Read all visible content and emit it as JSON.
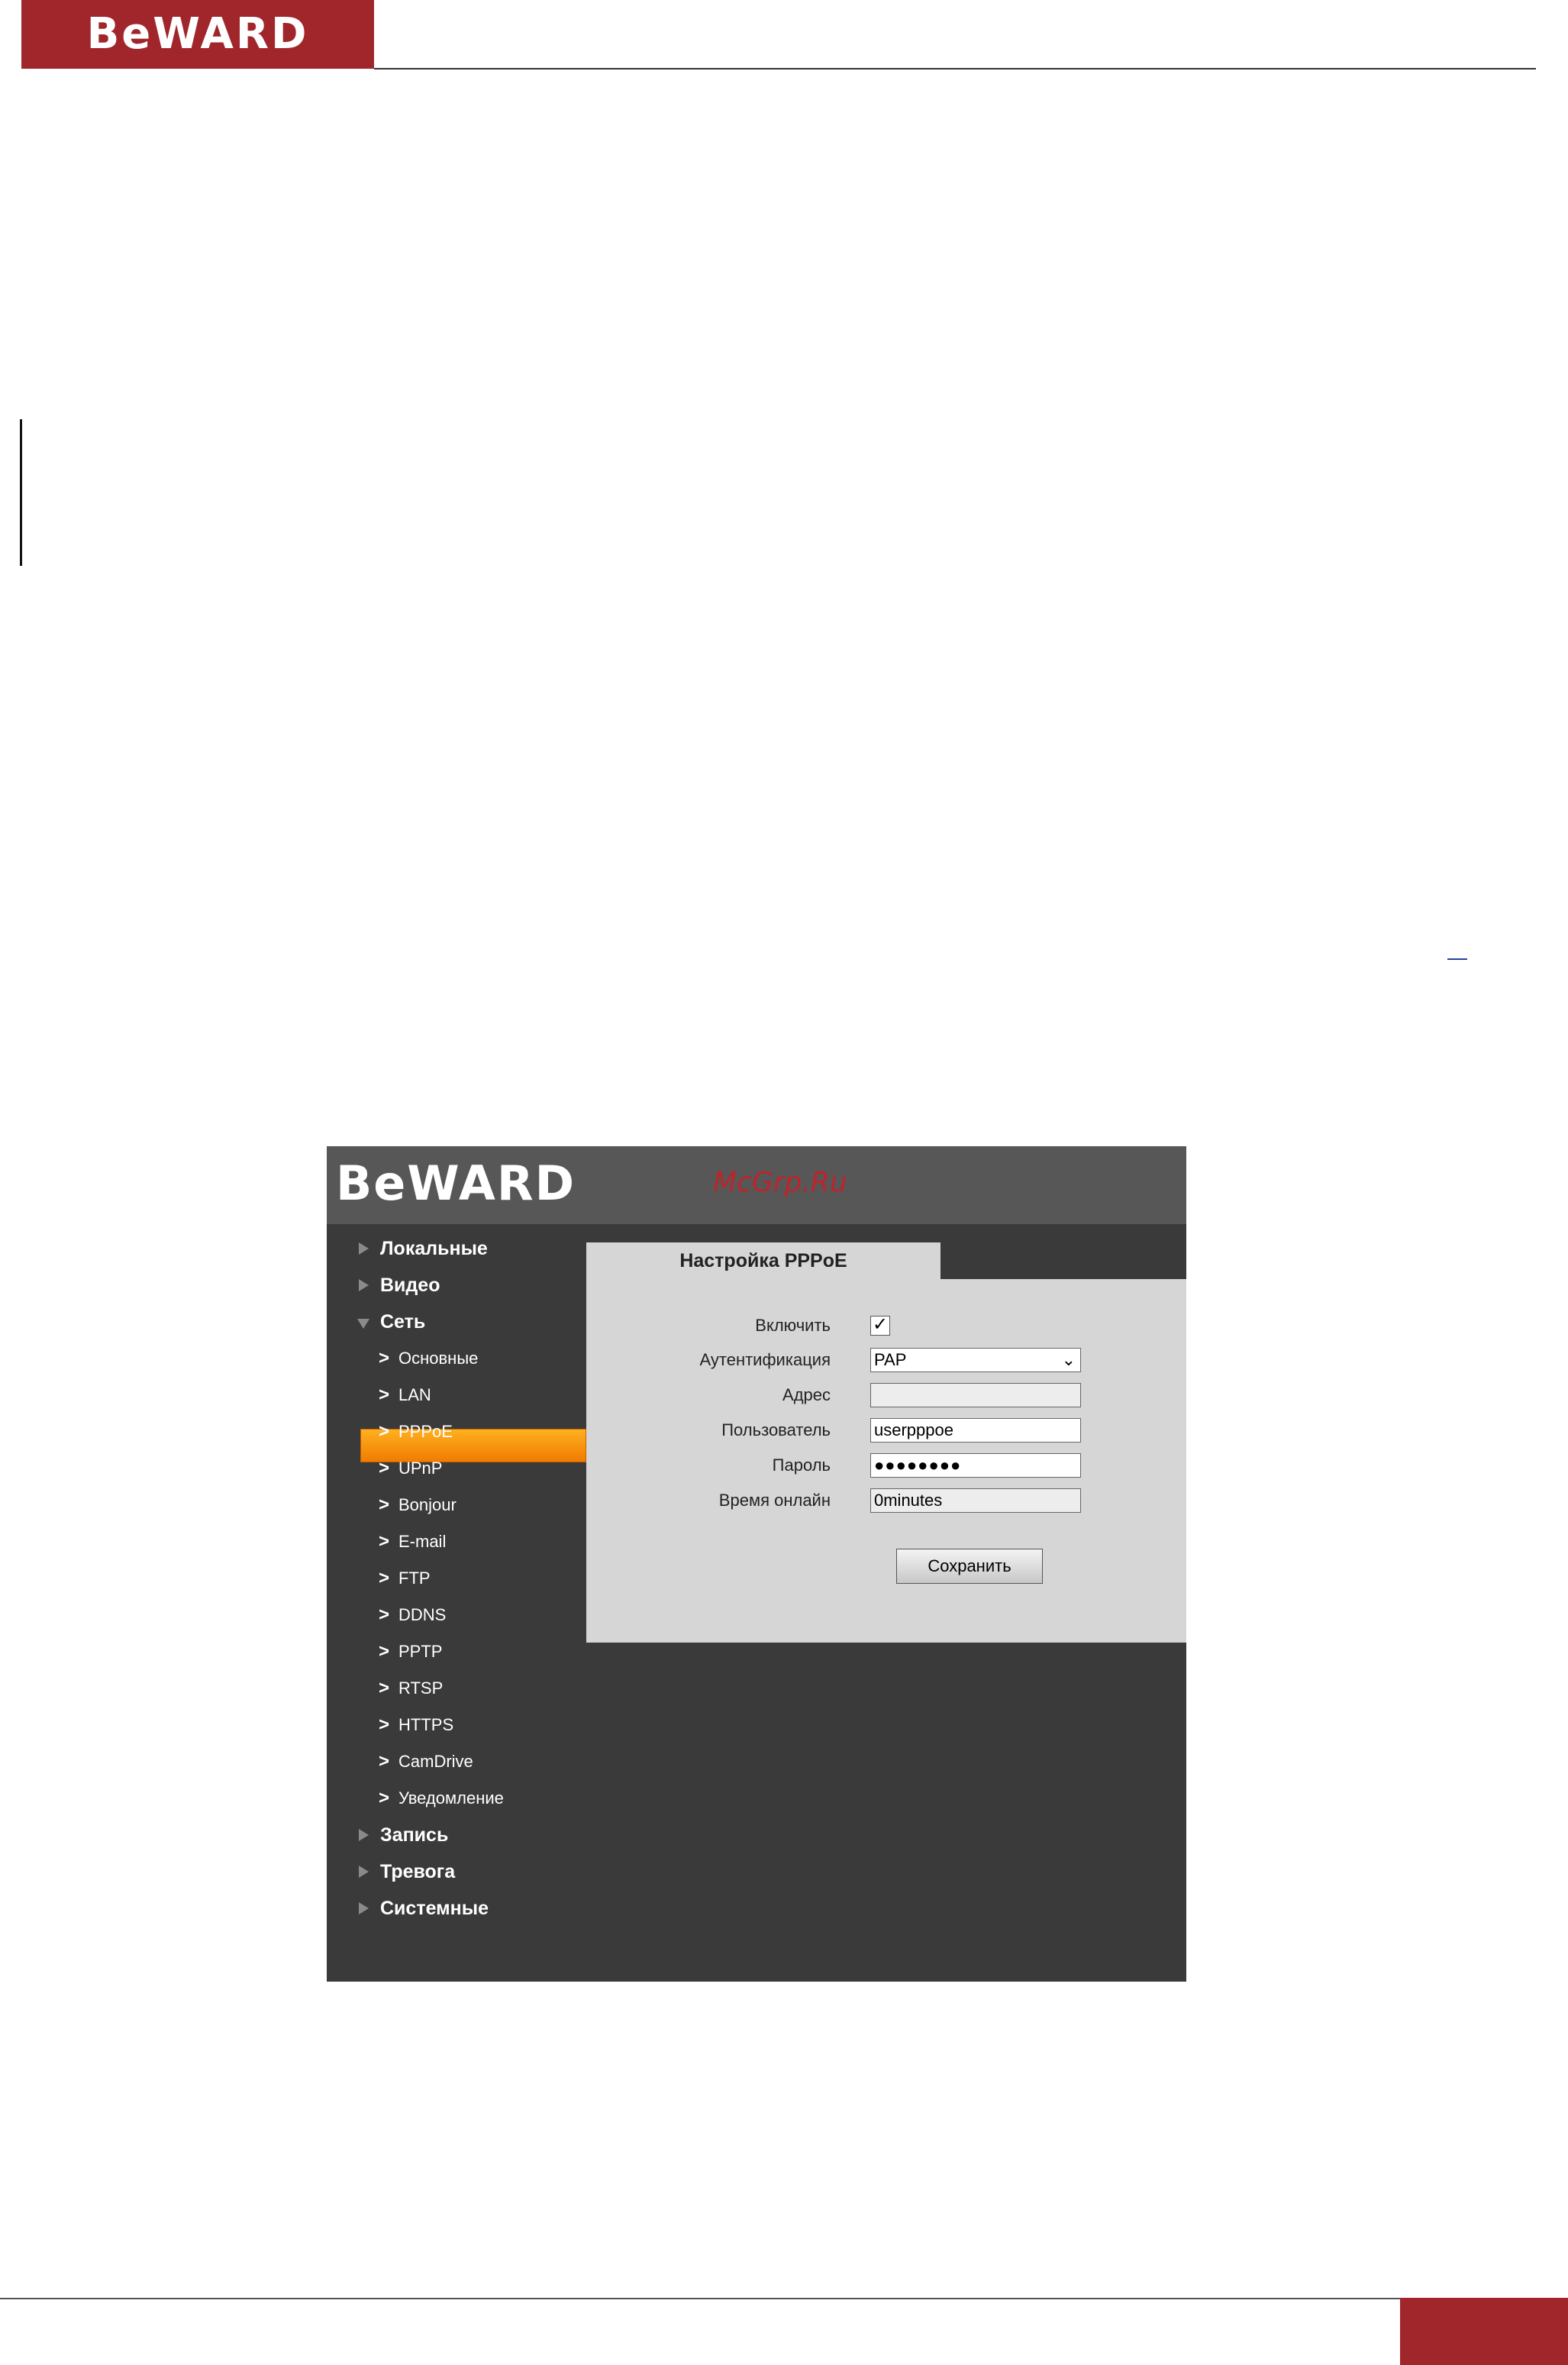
{
  "document": {
    "logo_text": "BeWARD"
  },
  "app": {
    "logo_text": "BeWARD",
    "watermark": "McGrp.Ru",
    "nav": {
      "local": "Локальные",
      "video": "Видео",
      "network": "Сеть",
      "record": "Запись",
      "alarm": "Тревога",
      "system": "Системные",
      "network_items": [
        "Основные",
        "LAN",
        "PPPoE",
        "UPnP",
        "Bonjour",
        "E-mail",
        "FTP",
        "DDNS",
        "PPTP",
        "RTSP",
        "HTTPS",
        "CamDrive",
        "Уведомление"
      ],
      "active_item": "PPPoE"
    },
    "tab_title": "Настройка PPPoE",
    "form": {
      "enable_label": "Включить",
      "enable_checked": true,
      "enable_mark": "✓",
      "auth_label": "Аутентификация",
      "auth_value": "PAP",
      "address_label": "Адрес",
      "address_value": "",
      "user_label": "Пользователь",
      "user_value": "userpppoe",
      "password_label": "Пароль",
      "password_value": "●●●●●●●●",
      "online_label": "Время онлайн",
      "online_value": "0minutes",
      "save_label": "Сохранить"
    },
    "icons": {
      "collapsed": "triangle-right-icon",
      "expanded": "triangle-down-icon",
      "sub": "chevron-right-icon"
    }
  }
}
